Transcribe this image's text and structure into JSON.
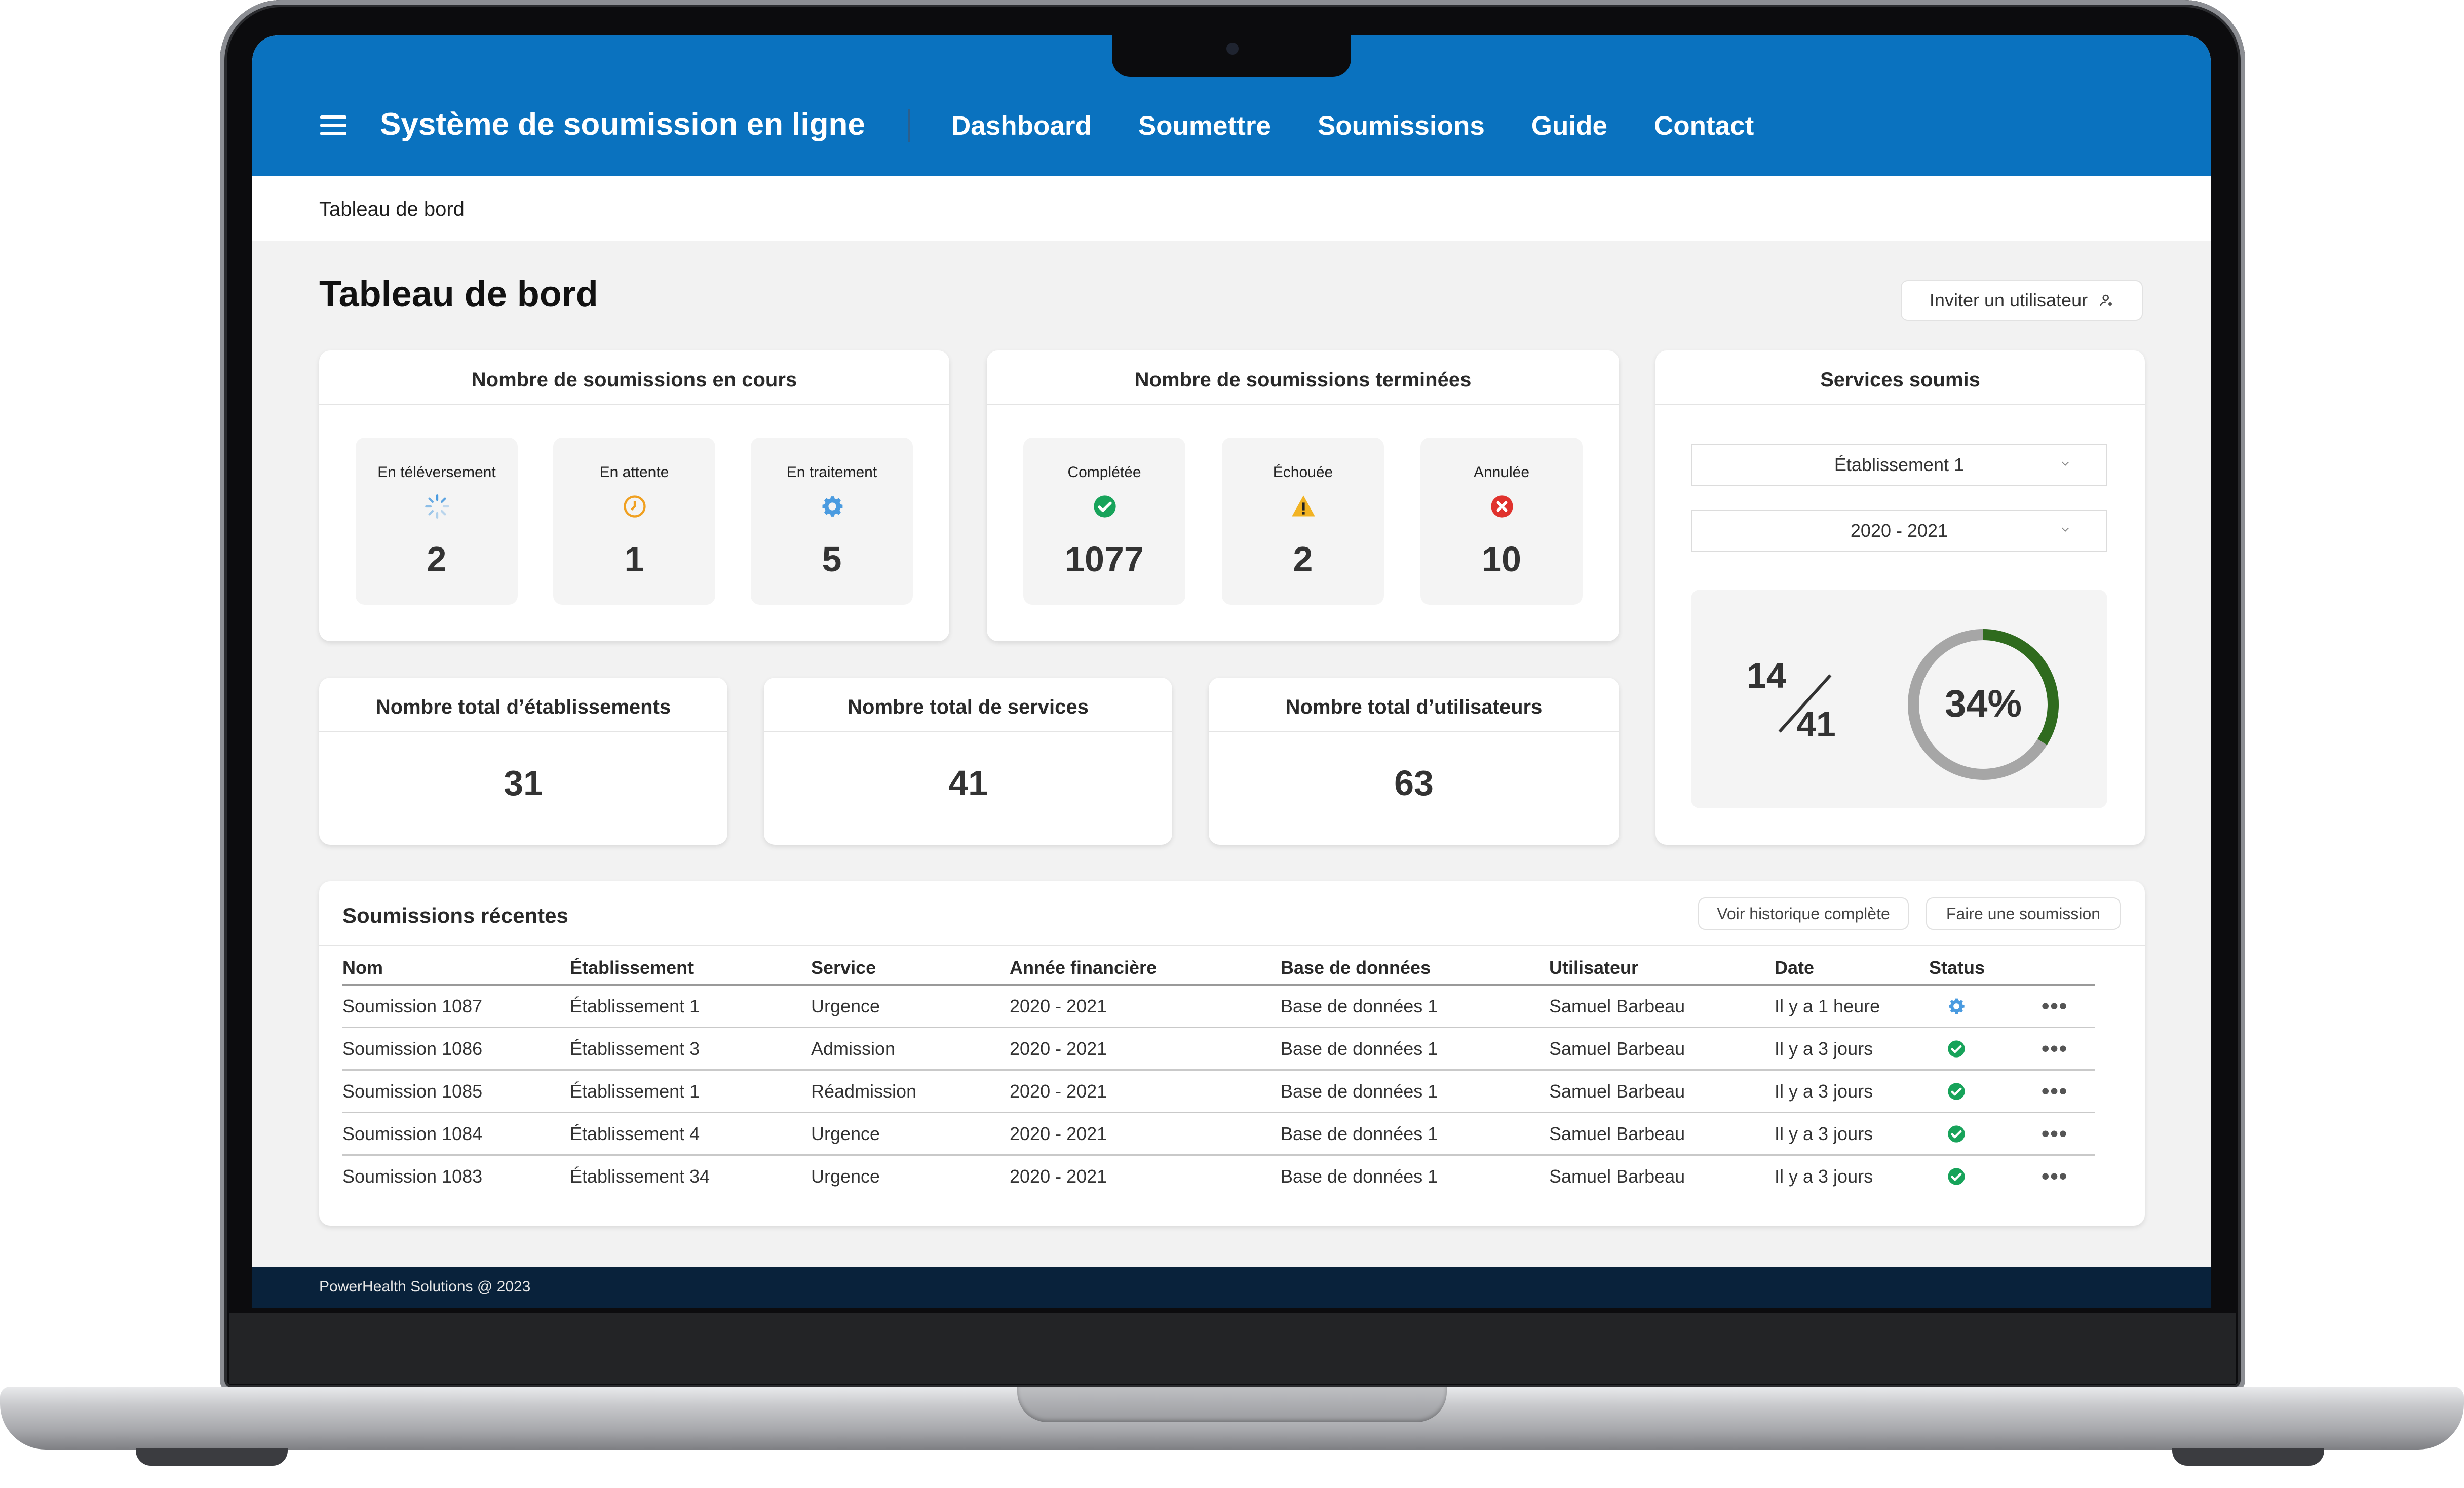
{
  "app": {
    "title": "Système de soumission en ligne",
    "brand_color": "#0a72bf"
  },
  "nav": [
    {
      "label": "Dashboard"
    },
    {
      "label": "Soumettre"
    },
    {
      "label": "Soumissions"
    },
    {
      "label": "Guide"
    },
    {
      "label": "Contact"
    }
  ],
  "breadcrumb": "Tableau de bord",
  "page": {
    "title": "Tableau de bord",
    "invite_label": "Inviter un utilisateur"
  },
  "in_progress": {
    "title": "Nombre de soumissions en cours",
    "stats": [
      {
        "label": "En téléversement",
        "icon": "loading-spinner-icon",
        "value": "2"
      },
      {
        "label": "En attente",
        "icon": "clock-icon",
        "value": "1"
      },
      {
        "label": "En traitement",
        "icon": "gear-icon",
        "value": "5"
      }
    ]
  },
  "finished": {
    "title": "Nombre de soumissions terminées",
    "stats": [
      {
        "label": "Complétée",
        "icon": "check-circle-icon",
        "value": "1077"
      },
      {
        "label": "Échouée",
        "icon": "warning-icon",
        "value": "2"
      },
      {
        "label": "Annulée",
        "icon": "error-circle-icon",
        "value": "10"
      }
    ]
  },
  "totals": [
    {
      "title": "Nombre total d’établissements",
      "value": "31"
    },
    {
      "title": "Nombre total de services",
      "value": "41"
    },
    {
      "title": "Nombre total d’utilisateurs",
      "value": "63"
    }
  ],
  "services": {
    "title": "Services soumis",
    "establishment_select": "Établissement 1",
    "year_select": "2020 - 2021",
    "submitted": "14",
    "total": "41",
    "percent_label": "34%",
    "percent": 0.34,
    "ring_color": "#2f6b1e",
    "track_color": "#a6a6a6"
  },
  "recent": {
    "title": "Soumissions récentes",
    "history_label": "Voir historique complète",
    "submit_label": "Faire une soumission",
    "columns": [
      "Nom",
      "Établissement",
      "Service",
      "Année financière",
      "Base de données",
      "Utilisateur",
      "Date",
      "Status"
    ],
    "rows": [
      {
        "name": "Soumission 1087",
        "establishment": "Établissement 1",
        "service": "Urgence",
        "year": "2020 - 2021",
        "database": "Base de données 1",
        "user": "Samuel Barbeau",
        "date": "Il y a 1 heure",
        "status": "processing"
      },
      {
        "name": "Soumission 1086",
        "establishment": "Établissement 3",
        "service": "Admission",
        "year": "2020 - 2021",
        "database": "Base de données 1",
        "user": "Samuel Barbeau",
        "date": "Il y a 3 jours",
        "status": "completed"
      },
      {
        "name": "Soumission 1085",
        "establishment": "Établissement 1",
        "service": "Réadmission",
        "year": "2020 - 2021",
        "database": "Base de données 1",
        "user": "Samuel Barbeau",
        "date": "Il y a 3 jours",
        "status": "completed"
      },
      {
        "name": "Soumission 1084",
        "establishment": "Établissement 4",
        "service": "Urgence",
        "year": "2020 - 2021",
        "database": "Base de données 1",
        "user": "Samuel Barbeau",
        "date": "Il y a 3 jours",
        "status": "completed"
      },
      {
        "name": "Soumission 1083",
        "establishment": "Établissement 34",
        "service": "Urgence",
        "year": "2020 - 2021",
        "database": "Base de données 1",
        "user": "Samuel Barbeau",
        "date": "Il y a 3 jours",
        "status": "completed"
      }
    ],
    "row_menu": "•••"
  },
  "footer": "PowerHealth Solutions @ 2023"
}
